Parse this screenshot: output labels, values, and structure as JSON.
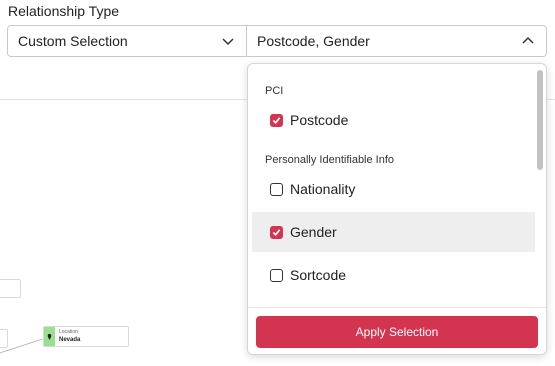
{
  "header": {
    "label": "Relationship Type",
    "left_select": {
      "value": "Custom Selection"
    },
    "right_select": {
      "value": "Postcode, Gender"
    }
  },
  "canvas": {
    "nodes": [
      {
        "type": "Location",
        "value": "Nevada",
        "color": "#9be08f"
      }
    ]
  },
  "dropdown": {
    "groups": [
      {
        "name": "PCI",
        "options": [
          {
            "label": "Postcode",
            "checked": true
          }
        ]
      },
      {
        "name": "Personally Identifiable Info",
        "options": [
          {
            "label": "Nationality",
            "checked": false
          },
          {
            "label": "Gender",
            "checked": true
          },
          {
            "label": "Sortcode",
            "checked": false
          }
        ]
      }
    ],
    "apply_label": "Apply Selection",
    "accent_color": "#d3344f"
  }
}
